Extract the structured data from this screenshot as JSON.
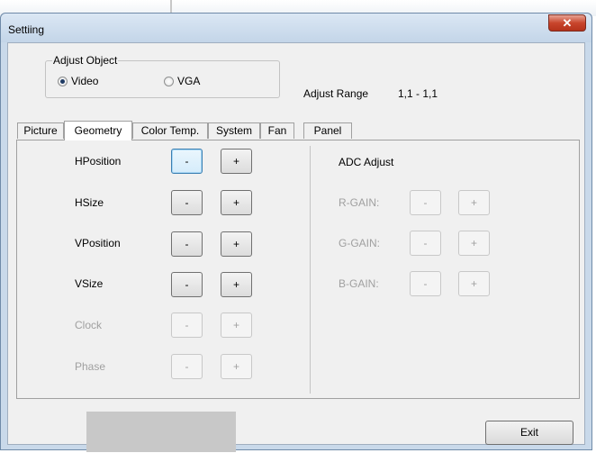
{
  "window": {
    "title": "Settiing",
    "close_glyph": "✕"
  },
  "adjust_object": {
    "legend": "Adjust Object",
    "options": [
      {
        "label": "Video",
        "checked": true
      },
      {
        "label": "VGA",
        "checked": false
      }
    ]
  },
  "adjust_range": {
    "label": "Adjust Range",
    "value": "1,1 - 1,1"
  },
  "tabs": [
    "Picture",
    "Geometry",
    "Color Temp.",
    "System",
    "Fan",
    "Panel"
  ],
  "active_tab": "Geometry",
  "geometry": {
    "rows": [
      {
        "label": "HPosition",
        "minus": "-",
        "plus": "+",
        "enabled": true
      },
      {
        "label": "HSize",
        "minus": "-",
        "plus": "+",
        "enabled": true
      },
      {
        "label": "VPosition",
        "minus": "-",
        "plus": "+",
        "enabled": true
      },
      {
        "label": "VSize",
        "minus": "-",
        "plus": "+",
        "enabled": true
      },
      {
        "label": "Clock",
        "minus": "-",
        "plus": "+",
        "enabled": false
      },
      {
        "label": "Phase",
        "minus": "-",
        "plus": "+",
        "enabled": false
      }
    ]
  },
  "adc": {
    "title": "ADC Adjust",
    "rows": [
      {
        "label": "R-GAIN:",
        "minus": "-",
        "plus": "+",
        "enabled": false
      },
      {
        "label": "G-GAIN:",
        "minus": "-",
        "plus": "+",
        "enabled": false
      },
      {
        "label": "B-GAIN:",
        "minus": "-",
        "plus": "+",
        "enabled": false
      }
    ]
  },
  "footer": {
    "exit_label": "Exit"
  }
}
